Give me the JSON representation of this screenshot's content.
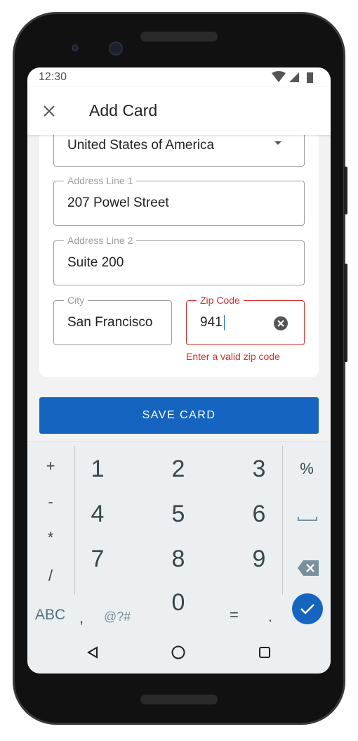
{
  "status": {
    "time": "12:30"
  },
  "header": {
    "title": "Add Card"
  },
  "form": {
    "country": "United States of America",
    "address1": {
      "label": "Address Line 1",
      "value": "207 Powel Street"
    },
    "address2": {
      "label": "Address Line 2",
      "value": "Suite 200"
    },
    "city": {
      "label": "City",
      "value": "San Francisco"
    },
    "zip": {
      "label": "Zip Code",
      "value": "941",
      "error": "Enter a valid zip code"
    }
  },
  "save_label": "SAVE CARD",
  "keyboard": {
    "left": [
      "+",
      "-",
      "*",
      "/"
    ],
    "digits": [
      "1",
      "2",
      "3",
      "4",
      "5",
      "6",
      "7",
      "8",
      "9",
      "0"
    ],
    "right": {
      "percent": "%"
    },
    "bottom": {
      "abc": "ABC",
      "comma": ",",
      "symbols": "@?#",
      "equals": "=",
      "period": "."
    }
  },
  "colors": {
    "accent": "#1565c0",
    "error": "#d32f2f"
  }
}
